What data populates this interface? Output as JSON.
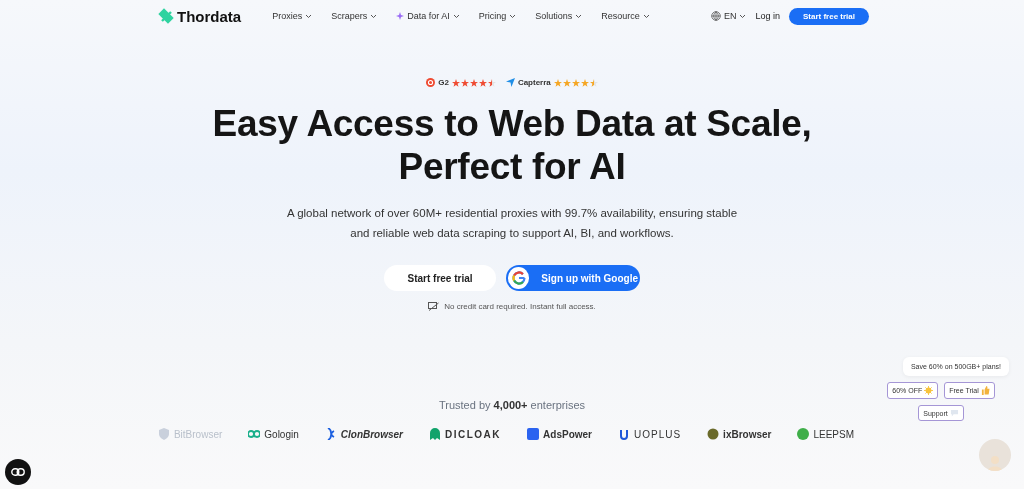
{
  "nav": {
    "brand": "Thordata",
    "items": [
      {
        "label": "Proxies",
        "sparkle": false
      },
      {
        "label": "Scrapers",
        "sparkle": false
      },
      {
        "label": "Data for AI",
        "sparkle": true
      },
      {
        "label": "Pricing",
        "sparkle": false
      },
      {
        "label": "Solutions",
        "sparkle": false
      },
      {
        "label": "Resource",
        "sparkle": false
      }
    ],
    "language": "EN",
    "login": "Log in",
    "cta": "Start free trial"
  },
  "ratings": [
    {
      "kind": "g2",
      "name": "G2",
      "stars": 4.5
    },
    {
      "kind": "capterra",
      "name": "Capterra",
      "stars": 4.5
    }
  ],
  "hero": {
    "title_lines": [
      "Easy Access to Web Data at Scale,",
      "Perfect for AI"
    ],
    "subtitle": "A global network of over 60M+ residential proxies with 99.7% availability, ensuring stable and reliable web data scraping to support AI, BI, and workflows.",
    "primary": "Start free trial",
    "google": "Sign up with Google",
    "note": "No credit card required. Instant full access."
  },
  "trusted": {
    "text": "Trusted by **4,000+** enterprises",
    "logos": [
      {
        "kind": "shield",
        "name": "BitBrowser",
        "color": "#c9d0dc"
      },
      {
        "kind": "rings",
        "name": "Gologin",
        "color": "#1aaf8b"
      },
      {
        "kind": "helix",
        "name": "ClonBrowser",
        "color": "#1b5fe0"
      },
      {
        "kind": "ghost",
        "name": "DICLOAK",
        "color": "#11a36b"
      },
      {
        "kind": "square",
        "name": "AdsPower",
        "color": "#2b63f0"
      },
      {
        "kind": "loop",
        "name": "UOPLUS",
        "color": "#1f57d8"
      },
      {
        "kind": "coin",
        "name": "ixBrowser",
        "color": "#6a6a2a"
      },
      {
        "kind": "dot",
        "name": "LEEPSM",
        "color": "#3fae49"
      }
    ]
  },
  "widget": {
    "message": "Save 60% on 500GB+ plans!",
    "chips": [
      {
        "kind": "sun",
        "label": "60% OFF"
      },
      {
        "kind": "thumb",
        "label": "Free Trial"
      },
      {
        "kind": "bubble",
        "label": "Support"
      }
    ]
  }
}
